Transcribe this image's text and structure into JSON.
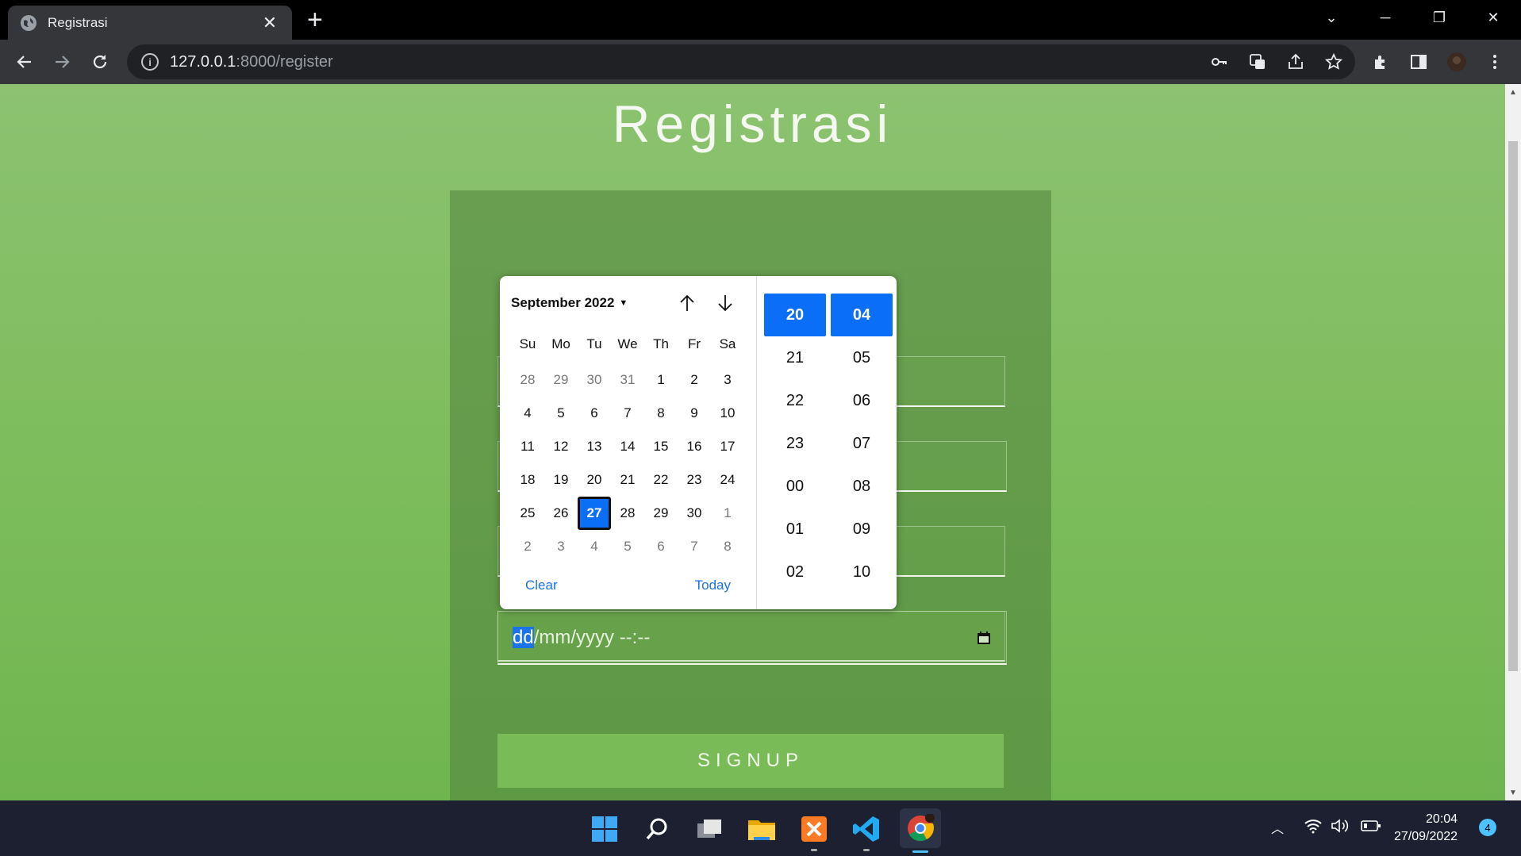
{
  "browser": {
    "tab_title": "Registrasi",
    "url_host": "127.0.0.1",
    "url_path": ":8000/register"
  },
  "page": {
    "title": "Registrasi",
    "date_input": {
      "highlighted": "dd",
      "rest": "/mm/yyyy --:--"
    },
    "signup_label": "SIGNUP"
  },
  "datepicker": {
    "month_label": "September 2022",
    "weekdays": [
      "Su",
      "Mo",
      "Tu",
      "We",
      "Th",
      "Fr",
      "Sa"
    ],
    "weeks": [
      [
        {
          "d": "28",
          "m": true
        },
        {
          "d": "29",
          "m": true
        },
        {
          "d": "30",
          "m": true
        },
        {
          "d": "31",
          "m": true
        },
        {
          "d": "1"
        },
        {
          "d": "2"
        },
        {
          "d": "3"
        }
      ],
      [
        {
          "d": "4"
        },
        {
          "d": "5"
        },
        {
          "d": "6"
        },
        {
          "d": "7"
        },
        {
          "d": "8"
        },
        {
          "d": "9"
        },
        {
          "d": "10"
        }
      ],
      [
        {
          "d": "11"
        },
        {
          "d": "12"
        },
        {
          "d": "13"
        },
        {
          "d": "14"
        },
        {
          "d": "15"
        },
        {
          "d": "16"
        },
        {
          "d": "17"
        }
      ],
      [
        {
          "d": "18"
        },
        {
          "d": "19"
        },
        {
          "d": "20"
        },
        {
          "d": "21"
        },
        {
          "d": "22"
        },
        {
          "d": "23"
        },
        {
          "d": "24"
        }
      ],
      [
        {
          "d": "25"
        },
        {
          "d": "26"
        },
        {
          "d": "27",
          "sel": true
        },
        {
          "d": "28"
        },
        {
          "d": "29"
        },
        {
          "d": "30"
        },
        {
          "d": "1",
          "m": true
        }
      ],
      [
        {
          "d": "2",
          "m": true
        },
        {
          "d": "3",
          "m": true
        },
        {
          "d": "4",
          "m": true
        },
        {
          "d": "5",
          "m": true
        },
        {
          "d": "6",
          "m": true
        },
        {
          "d": "7",
          "m": true
        },
        {
          "d": "8",
          "m": true
        }
      ]
    ],
    "clear_label": "Clear",
    "today_label": "Today",
    "hours": [
      "20",
      "21",
      "22",
      "23",
      "00",
      "01",
      "02"
    ],
    "minutes": [
      "04",
      "05",
      "06",
      "07",
      "08",
      "09",
      "10"
    ],
    "selected_hour": "20",
    "selected_minute": "04"
  },
  "taskbar": {
    "time": "20:04",
    "date": "27/09/2022",
    "notifications": "4",
    "apps": [
      "start-icon",
      "search-icon",
      "task-view-icon",
      "file-explorer-icon",
      "xampp-icon",
      "vscode-icon",
      "chrome-icon"
    ]
  },
  "colors": {
    "accent": "#0b6ef6",
    "page_green": "#7bbc5a",
    "signup_green": "#79bc57",
    "link_blue": "#1a73e8"
  }
}
